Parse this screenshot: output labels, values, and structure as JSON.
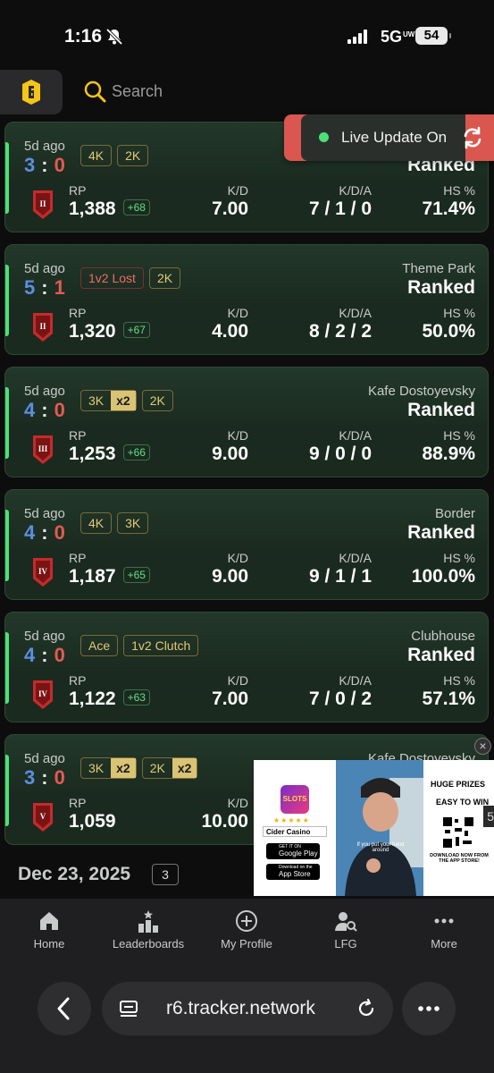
{
  "status_bar": {
    "time": "1:16",
    "network": "5G",
    "network_sup": "UW",
    "battery": "54"
  },
  "header": {
    "search_placeholder": "Search"
  },
  "toast": {
    "label": "Live Update On"
  },
  "matches": [
    {
      "age": "5d ago",
      "score_w": "3",
      "score_l": "0",
      "badges": [
        {
          "t": "4K"
        },
        {
          "t": "2K"
        }
      ],
      "map": "",
      "mode": "Ranked",
      "rank": "II",
      "rp_label": "RP",
      "rp": "1,388",
      "delta": "+68",
      "kd_label": "K/D",
      "kd": "7.00",
      "kda_label": "K/D/A",
      "kda": "7 / 1 / 0",
      "hs_label": "HS %",
      "hs": "71.4%"
    },
    {
      "age": "5d ago",
      "score_w": "5",
      "score_l": "1",
      "badges": [
        {
          "t": "1v2 Lost",
          "red": true
        },
        {
          "t": "2K"
        }
      ],
      "map": "Theme Park",
      "mode": "Ranked",
      "rank": "II",
      "rp_label": "RP",
      "rp": "1,320",
      "delta": "+67",
      "kd_label": "K/D",
      "kd": "4.00",
      "kda_label": "K/D/A",
      "kda": "8 / 2 / 2",
      "hs_label": "HS %",
      "hs": "50.0%"
    },
    {
      "age": "5d ago",
      "score_w": "4",
      "score_l": "0",
      "badges": [
        {
          "t": "3K",
          "mult": "x2"
        },
        {
          "t": "2K"
        }
      ],
      "map": "Kafe Dostoyevsky",
      "mode": "Ranked",
      "rank": "III",
      "rp_label": "RP",
      "rp": "1,253",
      "delta": "+66",
      "kd_label": "K/D",
      "kd": "9.00",
      "kda_label": "K/D/A",
      "kda": "9 / 0 / 0",
      "hs_label": "HS %",
      "hs": "88.9%"
    },
    {
      "age": "5d ago",
      "score_w": "4",
      "score_l": "0",
      "badges": [
        {
          "t": "4K"
        },
        {
          "t": "3K"
        }
      ],
      "map": "Border",
      "mode": "Ranked",
      "rank": "IV",
      "rp_label": "RP",
      "rp": "1,187",
      "delta": "+65",
      "kd_label": "K/D",
      "kd": "9.00",
      "kda_label": "K/D/A",
      "kda": "9 / 1 / 1",
      "hs_label": "HS %",
      "hs": "100.0%"
    },
    {
      "age": "5d ago",
      "score_w": "4",
      "score_l": "0",
      "badges": [
        {
          "t": "Ace"
        },
        {
          "t": "1v2 Clutch"
        }
      ],
      "map": "Clubhouse",
      "mode": "Ranked",
      "rank": "IV",
      "rp_label": "RP",
      "rp": "1,122",
      "delta": "+63",
      "kd_label": "K/D",
      "kd": "7.00",
      "kda_label": "K/D/A",
      "kda": "7 / 0 / 2",
      "hs_label": "HS %",
      "hs": "57.1%"
    },
    {
      "age": "5d ago",
      "score_w": "3",
      "score_l": "0",
      "badges": [
        {
          "t": "3K",
          "mult": "x2"
        },
        {
          "t": "2K",
          "mult": "x2"
        }
      ],
      "map": "Kafe Dostoyevsky",
      "mode": "",
      "rank": "V",
      "rp_label": "RP",
      "rp": "1,059",
      "delta": "",
      "kd_label": "K/D",
      "kd": "10.00",
      "kda_label": "",
      "kda": "",
      "hs_label": "",
      "hs": ""
    }
  ],
  "date_group": {
    "date": "Dec 23, 2025",
    "count": "3"
  },
  "ad": {
    "app_name": "Cider Casino",
    "logo_text": "SLOTS",
    "caption": "If you put your hand around",
    "headline1": "HUGE PRIZES",
    "headline2": "EASY TO WIN",
    "cta": "DOWNLOAD NOW FROM THE APP STORE!",
    "google_small": "GET IT ON",
    "google": "Google Play",
    "apple_small": "Download on the",
    "apple": "App Store",
    "close": "×",
    "edge": "5"
  },
  "bottom_nav": [
    {
      "label": "Home",
      "icon": "home-icon"
    },
    {
      "label": "Leaderboards",
      "icon": "leaderboards-icon"
    },
    {
      "label": "My Profile",
      "icon": "add-profile-icon"
    },
    {
      "label": "LFG",
      "icon": "user-search-icon"
    },
    {
      "label": "More",
      "icon": "more-dots-icon"
    }
  ],
  "browser": {
    "url": "r6.tracker.network"
  }
}
